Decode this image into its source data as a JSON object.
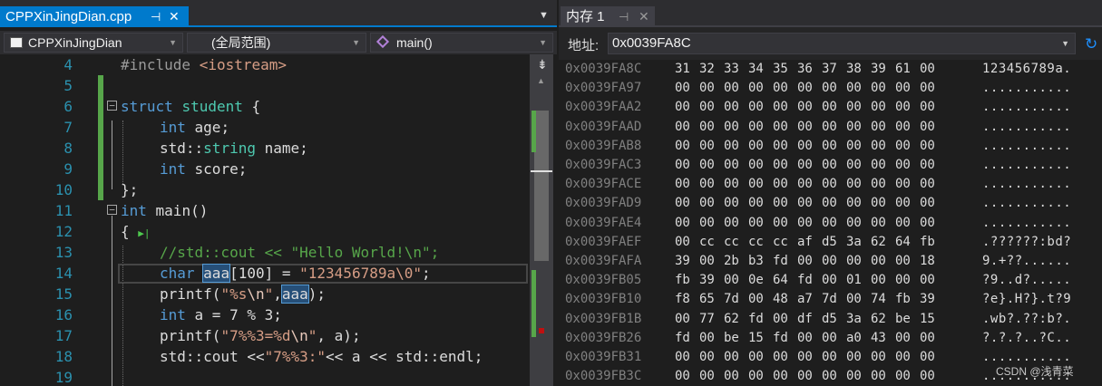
{
  "editor": {
    "tab_title": "CPPXinJingDian.cpp",
    "tab_pin": "⊣",
    "tab_close": "✕",
    "nav_project": "CPPXinJingDian",
    "nav_scope": "(全局范围)",
    "nav_function": "main()",
    "line_numbers": [
      "4",
      "5",
      "6",
      "7",
      "8",
      "9",
      "10",
      "11",
      "12",
      "13",
      "14",
      "15",
      "16",
      "17",
      "18",
      "19"
    ]
  },
  "memory": {
    "tab_title": "内存 1",
    "address_label": "地址:",
    "address_value": "0x0039FA8C",
    "rows": [
      {
        "addr": "0x0039FA8C",
        "bytes": [
          "31",
          "32",
          "33",
          "34",
          "35",
          "36",
          "37",
          "38",
          "39",
          "61",
          "00"
        ],
        "ascii": "123456789a."
      },
      {
        "addr": "0x0039FA97",
        "bytes": [
          "00",
          "00",
          "00",
          "00",
          "00",
          "00",
          "00",
          "00",
          "00",
          "00",
          "00"
        ],
        "ascii": "..........."
      },
      {
        "addr": "0x0039FAA2",
        "bytes": [
          "00",
          "00",
          "00",
          "00",
          "00",
          "00",
          "00",
          "00",
          "00",
          "00",
          "00"
        ],
        "ascii": "..........."
      },
      {
        "addr": "0x0039FAAD",
        "bytes": [
          "00",
          "00",
          "00",
          "00",
          "00",
          "00",
          "00",
          "00",
          "00",
          "00",
          "00"
        ],
        "ascii": "..........."
      },
      {
        "addr": "0x0039FAB8",
        "bytes": [
          "00",
          "00",
          "00",
          "00",
          "00",
          "00",
          "00",
          "00",
          "00",
          "00",
          "00"
        ],
        "ascii": "..........."
      },
      {
        "addr": "0x0039FAC3",
        "bytes": [
          "00",
          "00",
          "00",
          "00",
          "00",
          "00",
          "00",
          "00",
          "00",
          "00",
          "00"
        ],
        "ascii": "..........."
      },
      {
        "addr": "0x0039FACE",
        "bytes": [
          "00",
          "00",
          "00",
          "00",
          "00",
          "00",
          "00",
          "00",
          "00",
          "00",
          "00"
        ],
        "ascii": "..........."
      },
      {
        "addr": "0x0039FAD9",
        "bytes": [
          "00",
          "00",
          "00",
          "00",
          "00",
          "00",
          "00",
          "00",
          "00",
          "00",
          "00"
        ],
        "ascii": "..........."
      },
      {
        "addr": "0x0039FAE4",
        "bytes": [
          "00",
          "00",
          "00",
          "00",
          "00",
          "00",
          "00",
          "00",
          "00",
          "00",
          "00"
        ],
        "ascii": "..........."
      },
      {
        "addr": "0x0039FAEF",
        "bytes": [
          "00",
          "cc",
          "cc",
          "cc",
          "cc",
          "af",
          "d5",
          "3a",
          "62",
          "64",
          "fb"
        ],
        "ascii": ".??????:bd?"
      },
      {
        "addr": "0x0039FAFA",
        "bytes": [
          "39",
          "00",
          "2b",
          "b3",
          "fd",
          "00",
          "00",
          "00",
          "00",
          "00",
          "18"
        ],
        "ascii": "9.+??......"
      },
      {
        "addr": "0x0039FB05",
        "bytes": [
          "fb",
          "39",
          "00",
          "0e",
          "64",
          "fd",
          "00",
          "01",
          "00",
          "00",
          "00"
        ],
        "ascii": "?9..d?....."
      },
      {
        "addr": "0x0039FB10",
        "bytes": [
          "f8",
          "65",
          "7d",
          "00",
          "48",
          "a7",
          "7d",
          "00",
          "74",
          "fb",
          "39"
        ],
        "ascii": "?e}.H?}.t?9"
      },
      {
        "addr": "0x0039FB1B",
        "bytes": [
          "00",
          "77",
          "62",
          "fd",
          "00",
          "df",
          "d5",
          "3a",
          "62",
          "be",
          "15"
        ],
        "ascii": ".wb?.??:b?."
      },
      {
        "addr": "0x0039FB26",
        "bytes": [
          "fd",
          "00",
          "be",
          "15",
          "fd",
          "00",
          "00",
          "a0",
          "43",
          "00",
          "00"
        ],
        "ascii": "?.?.?..?C.."
      },
      {
        "addr": "0x0039FB31",
        "bytes": [
          "00",
          "00",
          "00",
          "00",
          "00",
          "00",
          "00",
          "00",
          "00",
          "00",
          "00"
        ],
        "ascii": "..........."
      },
      {
        "addr": "0x0039FB3C",
        "bytes": [
          "00",
          "00",
          "00",
          "00",
          "00",
          "00",
          "00",
          "00",
          "00",
          "00",
          "00"
        ],
        "ascii": "..........."
      }
    ]
  },
  "code": {
    "l4a": "#include ",
    "l4b": "<iostream>",
    "l6a": "struct ",
    "l6b": "student",
    "l6c": " {",
    "l7a": "int",
    "l7b": " age;",
    "l8a": "std::",
    "l8b": "string",
    "l8c": " name;",
    "l9a": "int",
    "l9b": " score;",
    "l10": "};",
    "l11a": "int",
    "l11b": " main()",
    "l12": "{",
    "l13": "//std::cout << \"Hello World!\\n\";",
    "l14a": "char",
    "l14b": "aaa",
    "l14c": "[100] = ",
    "l14d": "\"123456789a\\0\"",
    "l14e": ";",
    "l15a": "printf(",
    "l15b": "\"%s",
    "l15c": "\\n",
    "l15d": "\"",
    "l15e": ",",
    "l15f": "aaa",
    "l15g": ");",
    "l16a": "int",
    "l16b": " a = 7 % 3;",
    "l17a": "printf(",
    "l17b": "\"7%%3=%d",
    "l17c": "\\n",
    "l17d": "\"",
    "l17e": ", a);",
    "l18a": "std::cout <<",
    "l18b": "\"7%%3:\"",
    "l18c": "<< a << std::endl;"
  },
  "watermark": "CSDN @浅青菜",
  "colors": {
    "accent": "#007acc",
    "keyword": "#569cd6",
    "type": "#4ec9b0",
    "string": "#d69d85",
    "comment": "#57a64a",
    "line_number": "#2b91af"
  }
}
